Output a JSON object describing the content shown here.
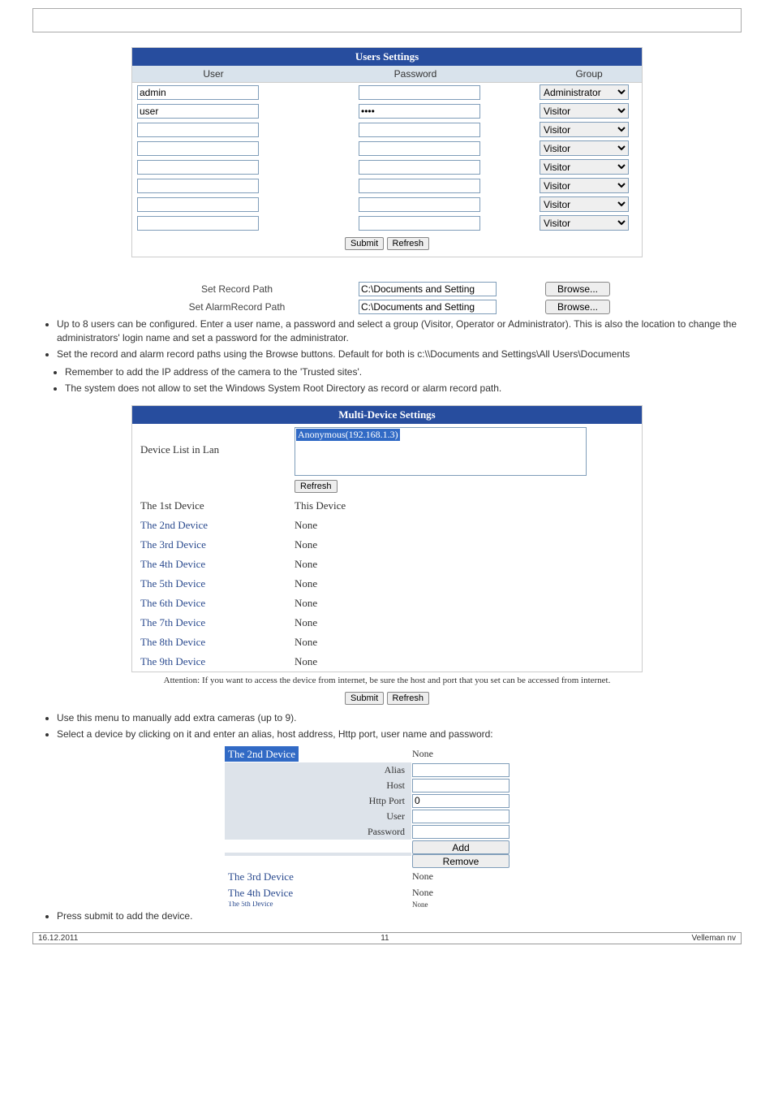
{
  "settings": {
    "title": "Users Settings",
    "headers": {
      "user": "User",
      "password": "Password",
      "group": "Group"
    },
    "rows": [
      {
        "user": "admin",
        "password": "",
        "group": "Administrator"
      },
      {
        "user": "user",
        "password": "••••",
        "group": "Visitor"
      },
      {
        "user": "",
        "password": "",
        "group": "Visitor"
      },
      {
        "user": "",
        "password": "",
        "group": "Visitor"
      },
      {
        "user": "",
        "password": "",
        "group": "Visitor"
      },
      {
        "user": "",
        "password": "",
        "group": "Visitor"
      },
      {
        "user": "",
        "password": "",
        "group": "Visitor"
      },
      {
        "user": "",
        "password": "",
        "group": "Visitor"
      }
    ],
    "submit": "Submit",
    "refresh": "Refresh"
  },
  "paths": {
    "record_label": "Set Record Path",
    "record_value": "C:\\Documents and Setting",
    "alarm_label": "Set AlarmRecord Path",
    "alarm_value": "C:\\Documents and Setting",
    "browse": "Browse..."
  },
  "ul1": "Up to 8 users can be configured. Enter a user name, a password and select a group (Visitor, Operator or Administrator). This is also the location to change the administrators' login name and set a password for the administrator.",
  "ul2": "Set the record and alarm record paths using the Browse buttons. Default for both is c:\\\\Documents and Settings\\All Users\\Documents",
  "inner1": "Remember to add the IP address of the camera to the 'Trusted sites'.",
  "inner2": "The system does not allow to set the Windows System Root Directory as record or alarm record path.",
  "multi": {
    "title": "Multi-Device Settings",
    "devlist_label": "Device List in Lan",
    "anon": "Anonymous(192.168.1.3)",
    "refresh": "Refresh",
    "dev1_label": "The 1st Device",
    "dev1_val": "This Device",
    "dev2_label": "The 2nd Device",
    "dev2_val": "None",
    "dev3_label": "The 3rd Device",
    "dev3_val": "None",
    "dev4_label": "The 4th Device",
    "dev4_val": "None",
    "dev5_label": "The 5th Device",
    "dev5_val": "None",
    "dev6_label": "The 6th Device",
    "dev6_val": "None",
    "dev7_label": "The 7th Device",
    "dev7_val": "None",
    "dev8_label": "The 8th Device",
    "dev8_val": "None",
    "dev9_label": "The 9th Device",
    "dev9_val": "None",
    "attention": "Attention: If you want to access the device from internet, be sure the host and port that you set can be accessed from internet.",
    "submit": "Submit",
    "refresh2": "Refresh"
  },
  "ul3": "Use this menu to manually add extra cameras (up to 9).",
  "ul4": "Select a device by clicking on it and enter an alias, host address, Http port, user name and password:",
  "dform": {
    "dev2": "The 2nd Device",
    "none": "None",
    "alias": "Alias",
    "host": "Host",
    "http": "Http Port",
    "http_val": "0",
    "user": "User",
    "pass": "Password",
    "add": "Add",
    "remove": "Remove",
    "dev3": "The 3rd Device",
    "dev4": "The 4th Device",
    "dev5cut": "The 5th Device",
    "nonecut": "None"
  },
  "ul5": "Press submit to add the device.",
  "footer": {
    "date": "16.12.2011",
    "page": "11",
    "company": "Velleman nv"
  }
}
